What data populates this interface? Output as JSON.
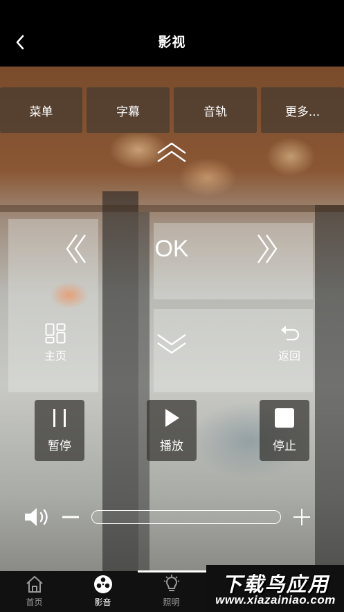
{
  "header": {
    "title": "影视",
    "back_icon": "chevron-left-icon"
  },
  "top_buttons": [
    "菜单",
    "字幕",
    "音轨",
    "更多..."
  ],
  "dpad": {
    "ok_label": "OK",
    "up_icon": "double-chevron-up-icon",
    "down_icon": "double-chevron-down-icon",
    "left_icon": "double-chevron-left-icon",
    "right_icon": "double-chevron-right-icon"
  },
  "home_cmd": {
    "label": "主页",
    "icon": "grid-icon"
  },
  "back_cmd": {
    "label": "返回",
    "icon": "undo-icon"
  },
  "playback": {
    "pause": "暂停",
    "play": "播放",
    "stop": "停止"
  },
  "volume": {
    "speaker_icon": "speaker-icon",
    "minus_icon": "minus-icon",
    "plus_icon": "plus-icon"
  },
  "tabs": [
    {
      "label": "首页",
      "icon": "home-icon"
    },
    {
      "label": "影音",
      "icon": "film-reel-icon",
      "active": true
    },
    {
      "label": "照明",
      "icon": "bulb-icon"
    }
  ],
  "watermark": {
    "title": "下载鸟应用",
    "url": "www.xiazainiao.com"
  }
}
